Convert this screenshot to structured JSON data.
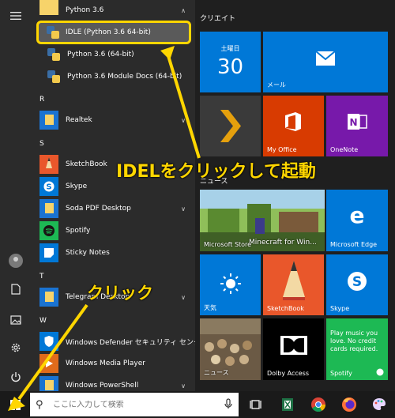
{
  "left_rail": {
    "icons": [
      "hamburger-menu-icon",
      "user-avatar-icon",
      "document-icon",
      "pictures-icon",
      "settings-gear-icon",
      "power-icon"
    ]
  },
  "app_list": {
    "python_folder": {
      "label": "Python 3.6",
      "expanded": true
    },
    "idle": {
      "label": "IDLE (Python 3.6 64-bit)",
      "highlighted": true
    },
    "python": {
      "label": "Python 3.6 (64-bit)"
    },
    "python_docs": {
      "label": "Python 3.6 Module Docs (64-bit)"
    },
    "letter_r": "R",
    "realtek": {
      "label": "Realtek"
    },
    "letter_s": "S",
    "sketchbook": {
      "label": "SketchBook"
    },
    "skype": {
      "label": "Skype"
    },
    "soda": {
      "label": "Soda PDF Desktop"
    },
    "spotify": {
      "label": "Spotify"
    },
    "sticky": {
      "label": "Sticky Notes"
    },
    "letter_t": "T",
    "telegram": {
      "label": "Telegram Desktop"
    },
    "letter_w": "W",
    "defender": {
      "label": "Windows Defender セキュリティ センター"
    },
    "mediaplayer": {
      "label": "Windows Media Player"
    },
    "powershell": {
      "label": "Windows PowerShell"
    }
  },
  "tiles": {
    "group1_title": "クリエイト",
    "calendar": {
      "weekday": "土曜日",
      "day": "30"
    },
    "mail": {
      "label": "メール"
    },
    "myoffice": {
      "label": "My Office"
    },
    "onenote": {
      "label": "OneNote"
    },
    "group2_title": "ニュース",
    "minecraft": {
      "label": "Microsoft Store",
      "overlay": "Minecraft for Win..."
    },
    "edge": {
      "label": "Microsoft Edge"
    },
    "weather": {
      "label": "天気"
    },
    "sketchbook": {
      "label": "SketchBook"
    },
    "skype": {
      "label": "Skype"
    },
    "news": {
      "label": "ニュース"
    },
    "dolby": {
      "label": "Dolby Access"
    },
    "spotify": {
      "label": "Spotify",
      "text": "Play music you love. No credit cards required."
    }
  },
  "taskbar": {
    "search_placeholder": "ここに入力して検索",
    "apps": [
      "task-view-icon",
      "spreadsheet-app-icon",
      "chrome-icon",
      "firefox-icon",
      "paint-app-icon"
    ]
  },
  "annotations": {
    "idel_text": "IDELをクリックして起動",
    "click_text": "クリック",
    "color": "#ffd600"
  },
  "colors": {
    "tile_blue": "#0078d7",
    "office_red": "#d83b01",
    "onenote_purple": "#7719aa",
    "spotify_green": "#1db954",
    "highlight": "#ffd600"
  }
}
